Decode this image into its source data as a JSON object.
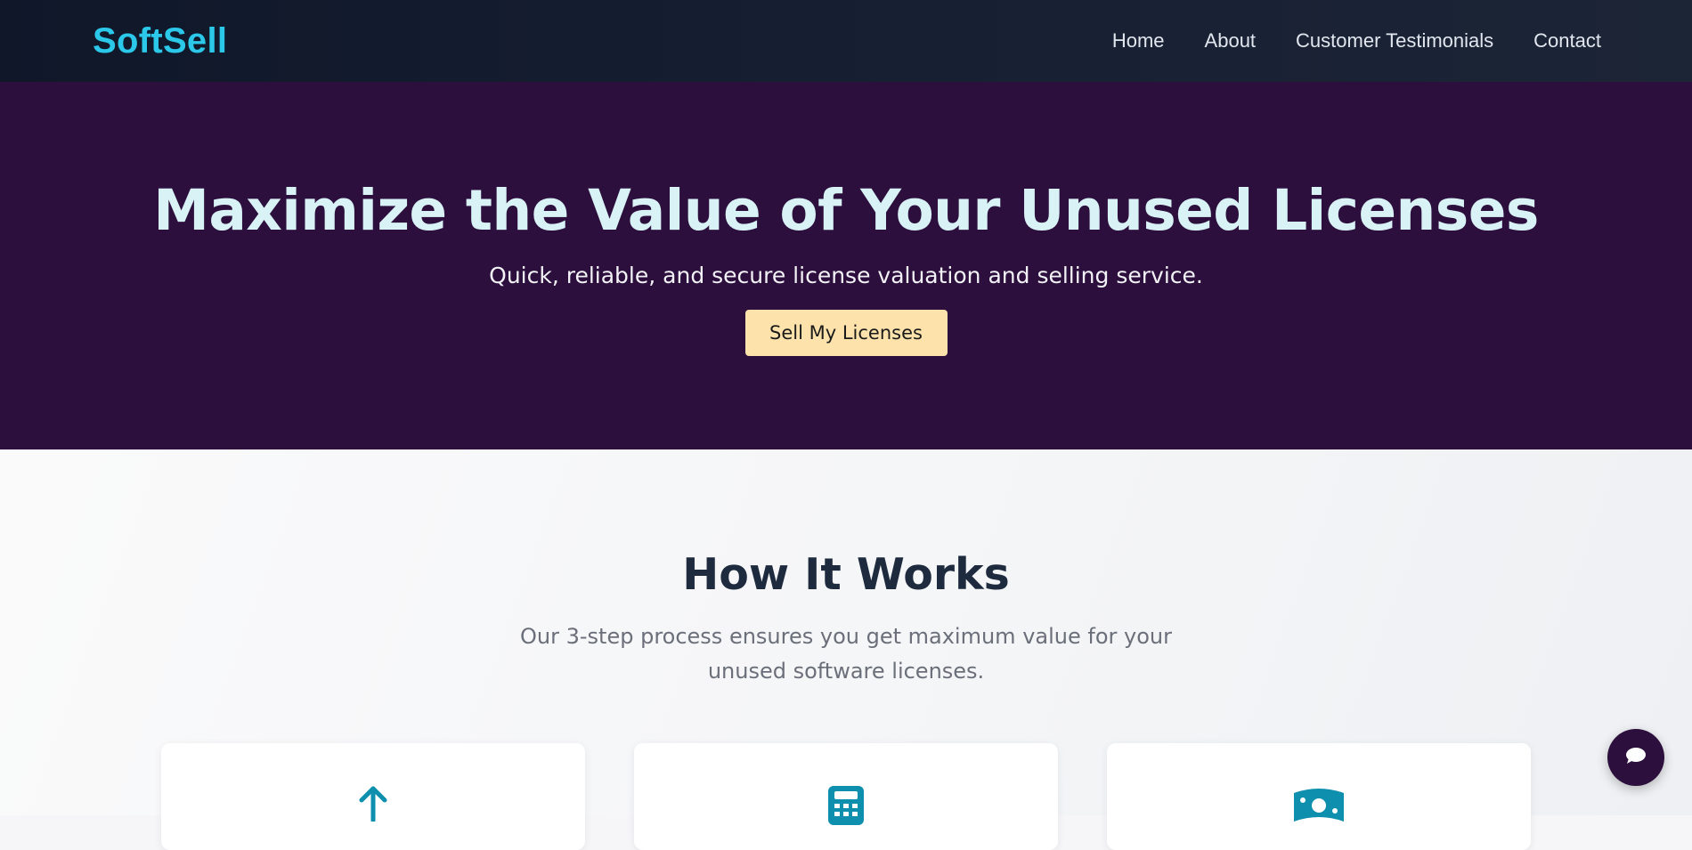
{
  "navbar": {
    "brand": "SoftSell",
    "links": [
      "Home",
      "About",
      "Customer Testimonials",
      "Contact"
    ]
  },
  "hero": {
    "title": "Maximize the Value of Your Unused Licenses",
    "subtitle": "Quick, reliable, and secure license valuation and selling service.",
    "cta_label": "Sell My Licenses"
  },
  "how_it_works": {
    "title": "How It Works",
    "subtitle": "Our 3-step process ensures you get maximum value for your unused software licenses.",
    "steps": [
      {
        "icon": "arrow-up-icon"
      },
      {
        "icon": "calculator-icon"
      },
      {
        "icon": "money-bill-icon"
      }
    ]
  },
  "chat": {
    "icon": "chat-bubble-icon"
  },
  "colors": {
    "brand": "#2bc8ea",
    "hero_bg": "#2c0f3d",
    "cta_bg": "#fde2ab",
    "icon_accent": "#0e8fae"
  }
}
